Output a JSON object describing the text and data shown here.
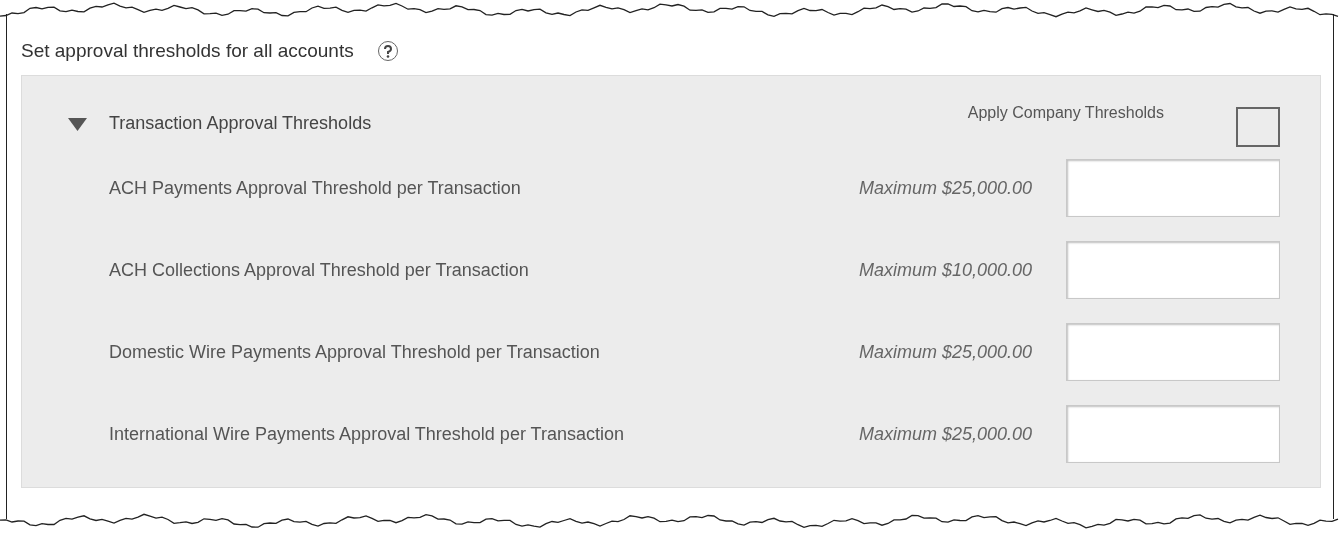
{
  "title": "Set approval thresholds for all accounts",
  "section": {
    "title": "Transaction Approval Thresholds",
    "expanded": true,
    "apply_company_thresholds": {
      "label": "Apply Company Thresholds",
      "checked": false
    },
    "rows": [
      {
        "label": "ACH Payments Approval Threshold per Transaction",
        "maximum": "Maximum $25,000.00"
      },
      {
        "label": "ACH Collections Approval Threshold per Transaction",
        "maximum": "Maximum $10,000.00"
      },
      {
        "label": "Domestic Wire Payments Approval Threshold per Transaction",
        "maximum": "Maximum $25,000.00"
      },
      {
        "label": "International Wire Payments Approval Threshold per Transaction",
        "maximum": "Maximum $25,000.00"
      }
    ]
  }
}
